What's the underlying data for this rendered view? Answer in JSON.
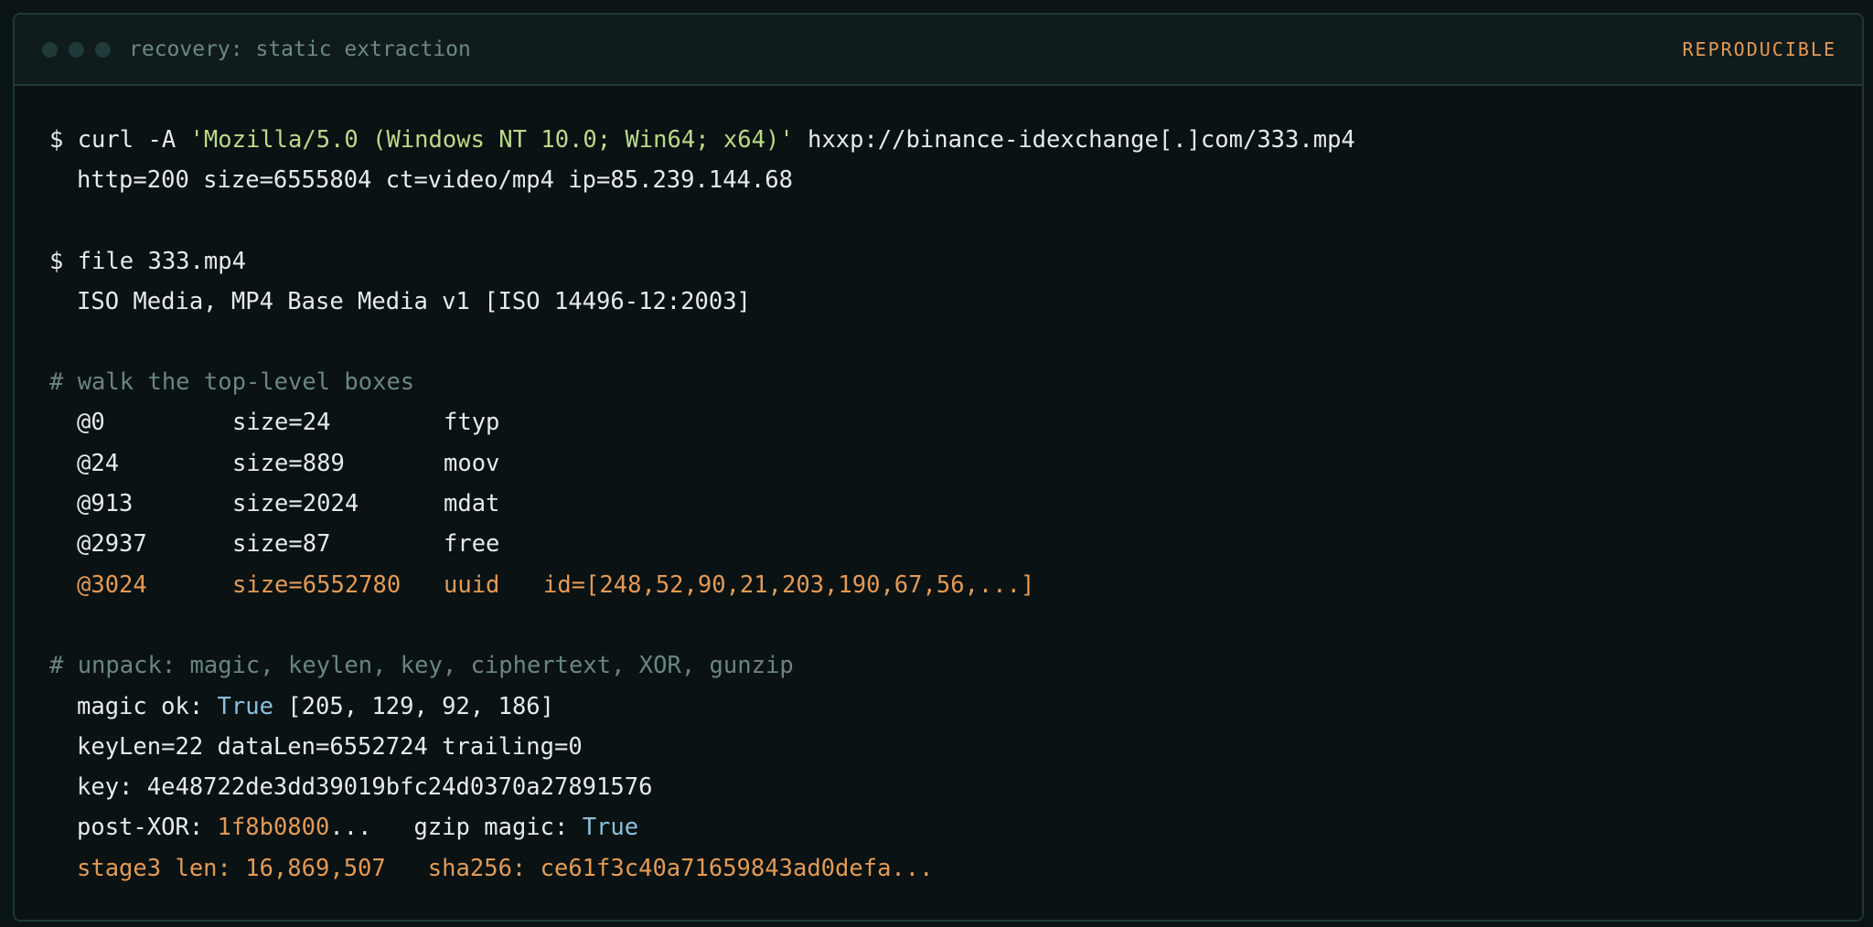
{
  "window": {
    "title": "recovery: static extraction",
    "badge": "REPRODUCIBLE"
  },
  "terminal": {
    "curl": {
      "prompt": "$ curl -A ",
      "user_agent": "'Mozilla/5.0 (Windows NT 10.0; Win64; x64)'",
      "url": " hxxp://binance-idexchange[.]com/333.mp4",
      "output": "http=200 size=6555804 ct=video/mp4 ip=85.239.144.68"
    },
    "file": {
      "command": "$ file 333.mp4",
      "output": "ISO Media, MP4 Base Media v1 [ISO 14496-12:2003]"
    },
    "boxes": {
      "comment": "# walk the top-level boxes",
      "rows": [
        {
          "offset": "@0",
          "size": "size=24",
          "type": "ftyp"
        },
        {
          "offset": "@24",
          "size": "size=889",
          "type": "moov"
        },
        {
          "offset": "@913",
          "size": "size=2024",
          "type": "mdat"
        },
        {
          "offset": "@2937",
          "size": "size=87",
          "type": "free"
        },
        {
          "offset": "@3024",
          "size": "size=6552780",
          "type": "uuid",
          "extra": "id=[248,52,90,21,203,190,67,56,...]"
        }
      ]
    },
    "unpack": {
      "comment": "# unpack: magic, keylen, key, ciphertext, XOR, gunzip",
      "magic_label": "magic ok: ",
      "magic_value": "True",
      "magic_bytes": " [205, 129, 92, 186]",
      "lengths": "keyLen=22 dataLen=6552724 trailing=0",
      "key": "key: 4e48722de3dd39019bfc24d0370a27891576",
      "postxor_label": "post-XOR: ",
      "postxor_value": "1f8b0800",
      "postxor_rest": "...   gzip magic: ",
      "gzip_value": "True",
      "stage3": "stage3 len: 16,869,507   sha256: ce61f3c40a71659843ad0defa..."
    }
  }
}
